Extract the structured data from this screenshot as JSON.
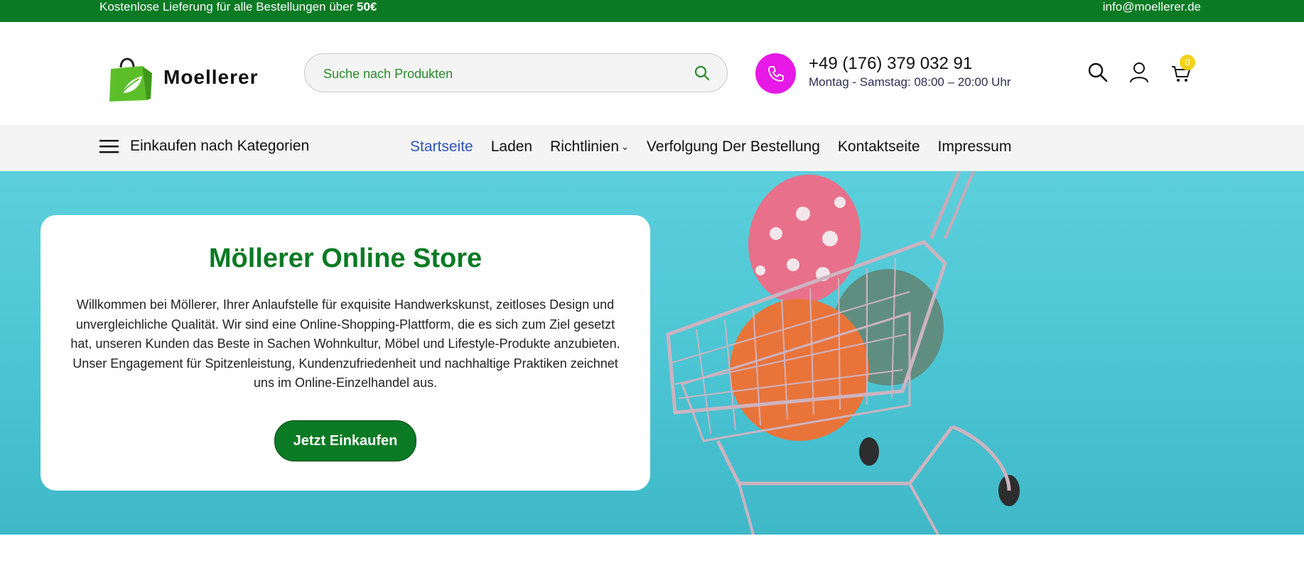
{
  "topbar": {
    "promo_text": "Kostenlose Lieferung für alle Bestellungen über",
    "promo_amount": "50€",
    "email": "info@moellerer.de"
  },
  "header": {
    "brand": "Moellerer",
    "search_placeholder": "Suche nach Produkten",
    "phone": "+49 (176) 379 032 91",
    "hours": "Montag - Samstag: 08:00 – 20:00 Uhr",
    "cart_count": "0"
  },
  "nav": {
    "categories_label": "Einkaufen nach Kategorien",
    "items": [
      {
        "label": "Startseite"
      },
      {
        "label": "Laden"
      },
      {
        "label": "Richtlinien"
      },
      {
        "label": "Verfolgung Der Bestellung"
      },
      {
        "label": "Kontaktseite"
      },
      {
        "label": "Impressum"
      }
    ]
  },
  "hero": {
    "title": "Möllerer Online Store",
    "text": "Willkommen bei Möllerer, Ihrer Anlaufstelle für exquisite Handwerkskunst, zeitloses Design und unvergleichliche Qualität. Wir sind eine Online-Shopping-Plattform, die es sich zum Ziel gesetzt hat, unseren Kunden das Beste in Sachen Wohnkultur, Möbel und Lifestyle-Produkte anzubieten. Unser Engagement für Spitzenleistung, Kundenzufriedenheit und nachhaltige Praktiken zeichnet uns im Online-Einzelhandel aus.",
    "button": "Jetzt Einkaufen"
  },
  "colors": {
    "brand_green": "#0a7a24",
    "phone_accent": "#e619e6",
    "active_link": "#2d54b7",
    "badge": "#f2d21a",
    "hero_bg": "#4cc6d4"
  },
  "icons": {
    "logo": "shopping-bag-leaf-icon",
    "search": "search-icon",
    "phone": "phone-icon",
    "user": "user-icon",
    "cart": "cart-icon",
    "menu": "hamburger-icon",
    "chevron": "chevron-down-icon"
  }
}
